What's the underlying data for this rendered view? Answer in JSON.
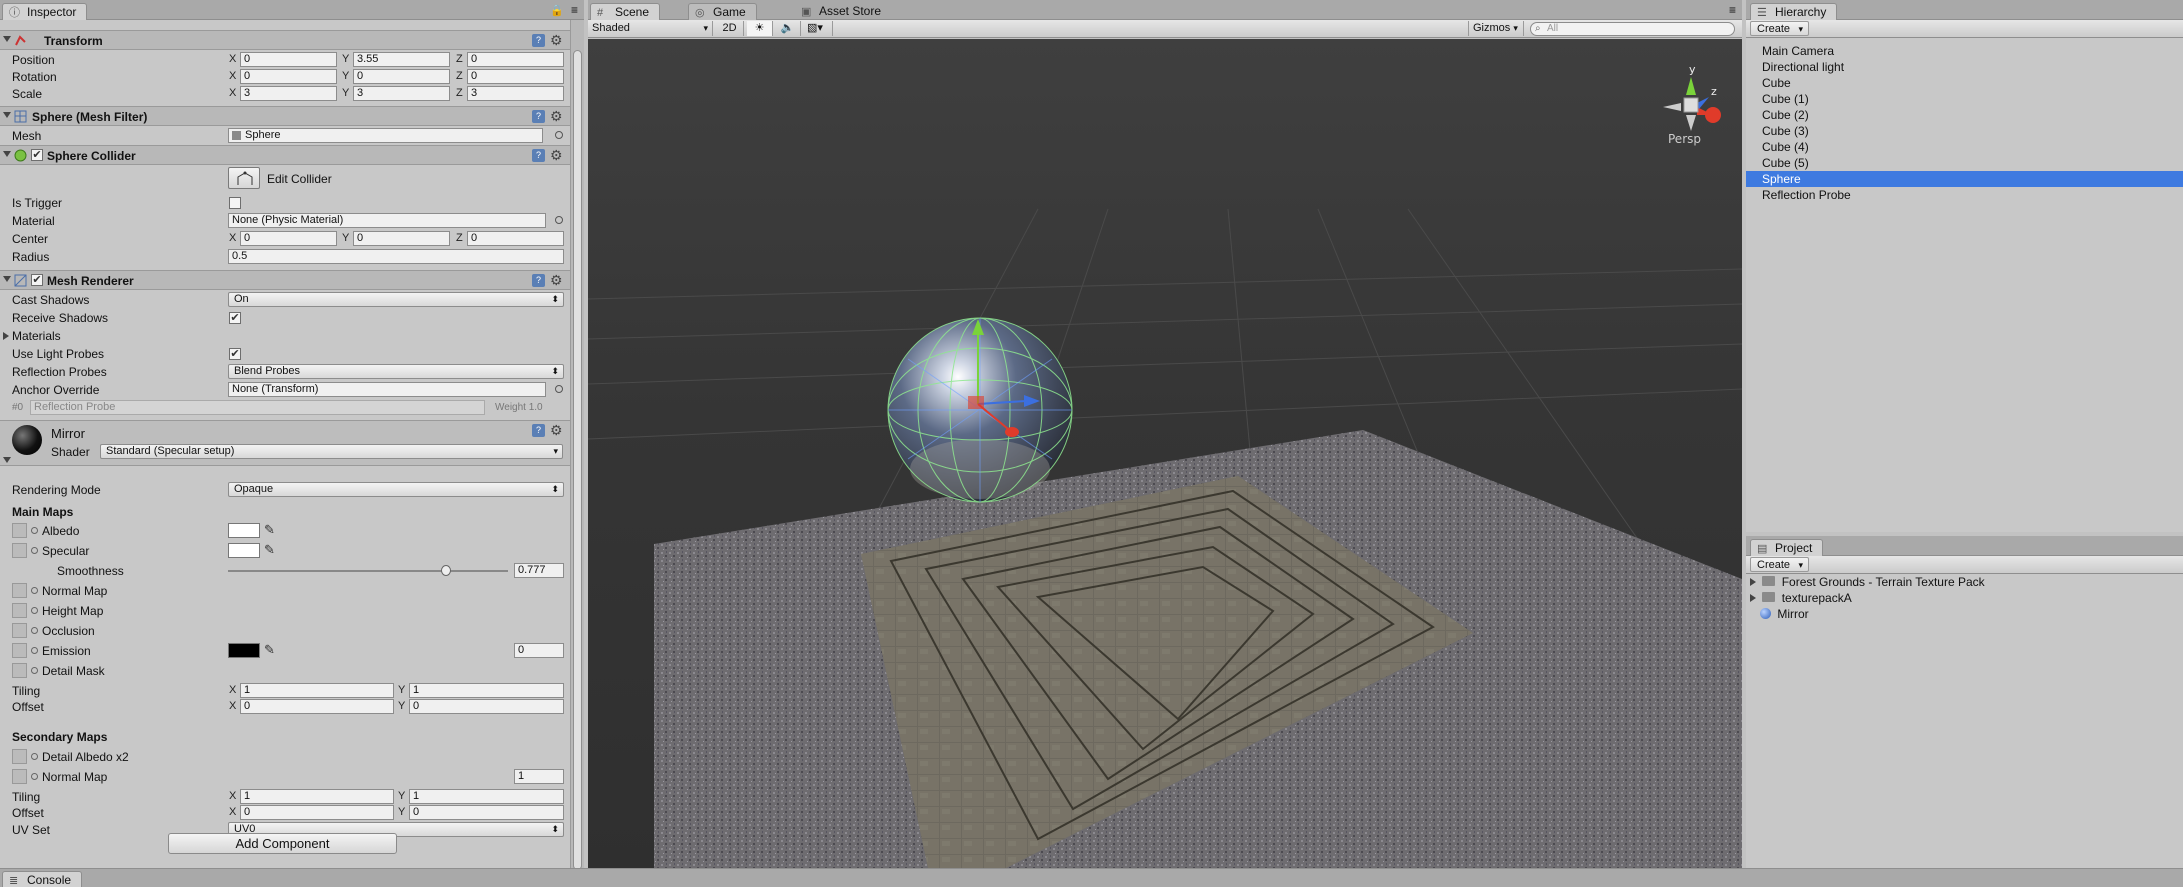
{
  "inspector": {
    "tab": "Inspector",
    "transform": {
      "title": "Transform",
      "position": {
        "label": "Position",
        "x": "0",
        "y": "3.55",
        "z": "0"
      },
      "rotation": {
        "label": "Rotation",
        "x": "0",
        "y": "0",
        "z": "0"
      },
      "scale": {
        "label": "Scale",
        "x": "3",
        "y": "3",
        "z": "3"
      }
    },
    "mesh_filter": {
      "title": "Sphere (Mesh Filter)",
      "mesh_label": "Mesh",
      "mesh_value": "Sphere"
    },
    "sphere_collider": {
      "title": "Sphere Collider",
      "edit_label": "Edit Collider",
      "is_trigger_label": "Is Trigger",
      "material_label": "Material",
      "material_value": "None (Physic Material)",
      "center_label": "Center",
      "center_x": "0",
      "center_y": "0",
      "center_z": "0",
      "radius_label": "Radius",
      "radius_value": "0.5"
    },
    "mesh_renderer": {
      "title": "Mesh Renderer",
      "cast_shadows_label": "Cast Shadows",
      "cast_shadows_value": "On",
      "receive_shadows_label": "Receive Shadows",
      "materials_label": "Materials",
      "use_light_probes_label": "Use Light Probes",
      "reflection_probes_label": "Reflection Probes",
      "reflection_probes_value": "Blend Probes",
      "anchor_override_label": "Anchor Override",
      "anchor_override_value": "None (Transform)",
      "probe_row_label": "Reflection Probe",
      "probe_row_index": "#0",
      "probe_row_weight": "Weight 1.0"
    },
    "material": {
      "name": "Mirror",
      "shader_label": "Shader",
      "shader_value": "Standard (Specular setup)",
      "rendering_mode_label": "Rendering Mode",
      "rendering_mode_value": "Opaque",
      "main_maps_label": "Main Maps",
      "albedo_label": "Albedo",
      "specular_label": "Specular",
      "smoothness_label": "Smoothness",
      "smoothness_value": "0.777",
      "smoothness": 0.777,
      "normal_map_label": "Normal Map",
      "height_map_label": "Height Map",
      "occlusion_label": "Occlusion",
      "emission_label": "Emission",
      "emission_value": "0",
      "detail_mask_label": "Detail Mask",
      "tiling_label": "Tiling",
      "tiling_x": "1",
      "tiling_y": "1",
      "offset_label": "Offset",
      "offset_x": "0",
      "offset_y": "0",
      "secondary_maps_label": "Secondary Maps",
      "detail_albedo_label": "Detail Albedo x2",
      "normal_map2_label": "Normal Map",
      "normal_map2_value": "1",
      "tiling2_label": "Tiling",
      "tiling2_x": "1",
      "tiling2_y": "1",
      "offset2_label": "Offset",
      "offset2_x": "0",
      "offset2_y": "0",
      "uv_set_label": "UV Set",
      "uv_set_value": "UV0"
    },
    "add_component": "Add Component"
  },
  "scene": {
    "tabs": [
      "Scene",
      "Game",
      "Asset Store"
    ],
    "shading_mode": "Shaded",
    "mode_2d": "2D",
    "gizmos": "Gizmos",
    "search_placeholder": "All",
    "persp_label": "Persp",
    "axis_y": "y",
    "axis_z": "z"
  },
  "hierarchy": {
    "tab": "Hierarchy",
    "create": "Create",
    "items": [
      "Main Camera",
      "Directional light",
      "Cube",
      "Cube (1)",
      "Cube (2)",
      "Cube (3)",
      "Cube (4)",
      "Cube (5)",
      "Sphere",
      "Reflection Probe"
    ],
    "selected": "Sphere"
  },
  "project": {
    "tab": "Project",
    "create": "Create",
    "items": [
      "Forest Grounds - Terrain Texture Pack",
      "texturepackA",
      "Mirror"
    ]
  },
  "console": {
    "tab": "Console"
  },
  "colors": {
    "selection": "#3e7ae0",
    "viewport_bg": "#3b3b3b",
    "panel_bg": "#c2c2c2"
  }
}
